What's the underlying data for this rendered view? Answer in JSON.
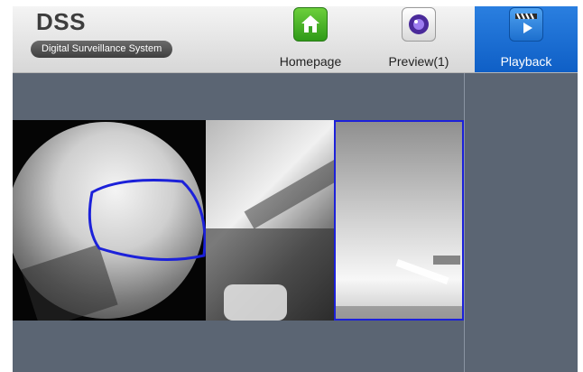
{
  "header": {
    "brand_title": "DSS",
    "brand_subtitle": "Digital Surveillance System"
  },
  "nav": {
    "items": [
      {
        "label": "Homepage",
        "icon": "home-icon",
        "active": false
      },
      {
        "label": "Preview(1)",
        "icon": "camera-lens-icon",
        "active": false
      },
      {
        "label": "Playback",
        "icon": "playback-clapper-icon",
        "active": true
      }
    ]
  },
  "colors": {
    "active_nav": "#1d6fce",
    "workspace_bg": "#5b6573",
    "selection_border": "#1c21d9"
  }
}
